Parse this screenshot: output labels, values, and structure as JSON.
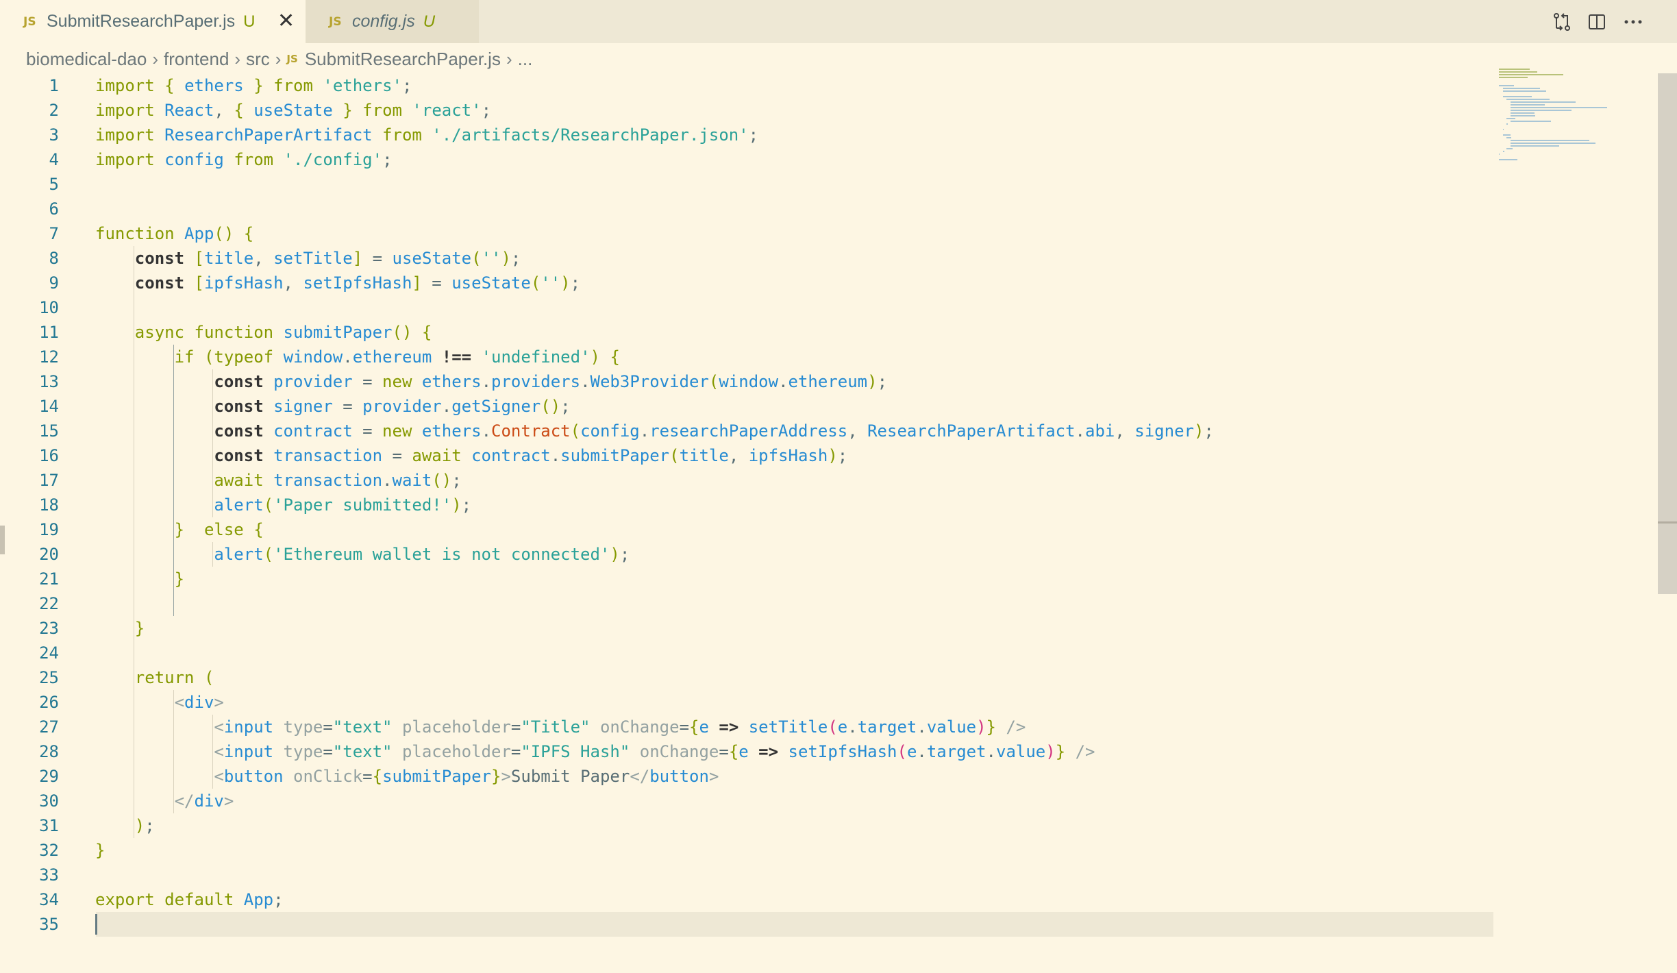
{
  "tabs": [
    {
      "icon": "JS",
      "label": "SubmitResearchPaper.js",
      "status": "U",
      "active": true
    },
    {
      "icon": "JS",
      "label": "config.js",
      "status": "U",
      "active": false
    }
  ],
  "actions": [
    "source-control-icon",
    "split-editor-icon",
    "more-actions-icon"
  ],
  "breadcrumb": {
    "items": [
      "biomedical-dao",
      "frontend",
      "src"
    ],
    "file_icon": "JS",
    "file": "SubmitResearchPaper.js",
    "ellipsis": "..."
  },
  "colors": {
    "accent": "#859900",
    "function": "#268bd2",
    "string": "#2aa198",
    "line_number": "#237893"
  },
  "editor": {
    "current_line": 35,
    "lines": [
      {
        "n": "1",
        "text": "import { ethers } from 'ethers';"
      },
      {
        "n": "2",
        "text": "import React, { useState } from 'react';"
      },
      {
        "n": "3",
        "text": "import ResearchPaperArtifact from './artifacts/ResearchPaper.json';"
      },
      {
        "n": "4",
        "text": "import config from './config';"
      },
      {
        "n": "5",
        "text": ""
      },
      {
        "n": "6",
        "text": ""
      },
      {
        "n": "7",
        "text": "function App() {"
      },
      {
        "n": "8",
        "text": "    const [title, setTitle] = useState('');"
      },
      {
        "n": "9",
        "text": "    const [ipfsHash, setIpfsHash] = useState('');"
      },
      {
        "n": "10",
        "text": ""
      },
      {
        "n": "11",
        "text": "    async function submitPaper() {"
      },
      {
        "n": "12",
        "text": "        if (typeof window.ethereum !== 'undefined') {"
      },
      {
        "n": "13",
        "text": "            const provider = new ethers.providers.Web3Provider(window.ethereum);"
      },
      {
        "n": "14",
        "text": "            const signer = provider.getSigner();"
      },
      {
        "n": "15",
        "text": "            const contract = new ethers.Contract(config.researchPaperAddress, ResearchPaperArtifact.abi, signer);"
      },
      {
        "n": "16",
        "text": "            const transaction = await contract.submitPaper(title, ipfsHash);"
      },
      {
        "n": "17",
        "text": "            await transaction.wait();"
      },
      {
        "n": "18",
        "text": "            alert('Paper submitted!');"
      },
      {
        "n": "19",
        "text": "        }  else {"
      },
      {
        "n": "20",
        "text": "            alert('Ethereum wallet is not connected');"
      },
      {
        "n": "21",
        "text": "        }"
      },
      {
        "n": "22",
        "text": ""
      },
      {
        "n": "23",
        "text": "    }"
      },
      {
        "n": "24",
        "text": ""
      },
      {
        "n": "25",
        "text": "    return ("
      },
      {
        "n": "26",
        "text": "        <div>"
      },
      {
        "n": "27",
        "text": "            <input type=\"text\" placeholder=\"Title\" onChange={e => setTitle(e.target.value)} />"
      },
      {
        "n": "28",
        "text": "            <input type=\"text\" placeholder=\"IPFS Hash\" onChange={e => setIpfsHash(e.target.value)} />"
      },
      {
        "n": "29",
        "text": "            <button onClick={submitPaper}>Submit Paper</button>"
      },
      {
        "n": "30",
        "text": "        </div>"
      },
      {
        "n": "31",
        "text": "    );"
      },
      {
        "n": "32",
        "text": "}"
      },
      {
        "n": "33",
        "text": ""
      },
      {
        "n": "34",
        "text": "export default App;"
      },
      {
        "n": "35",
        "text": ""
      }
    ]
  }
}
